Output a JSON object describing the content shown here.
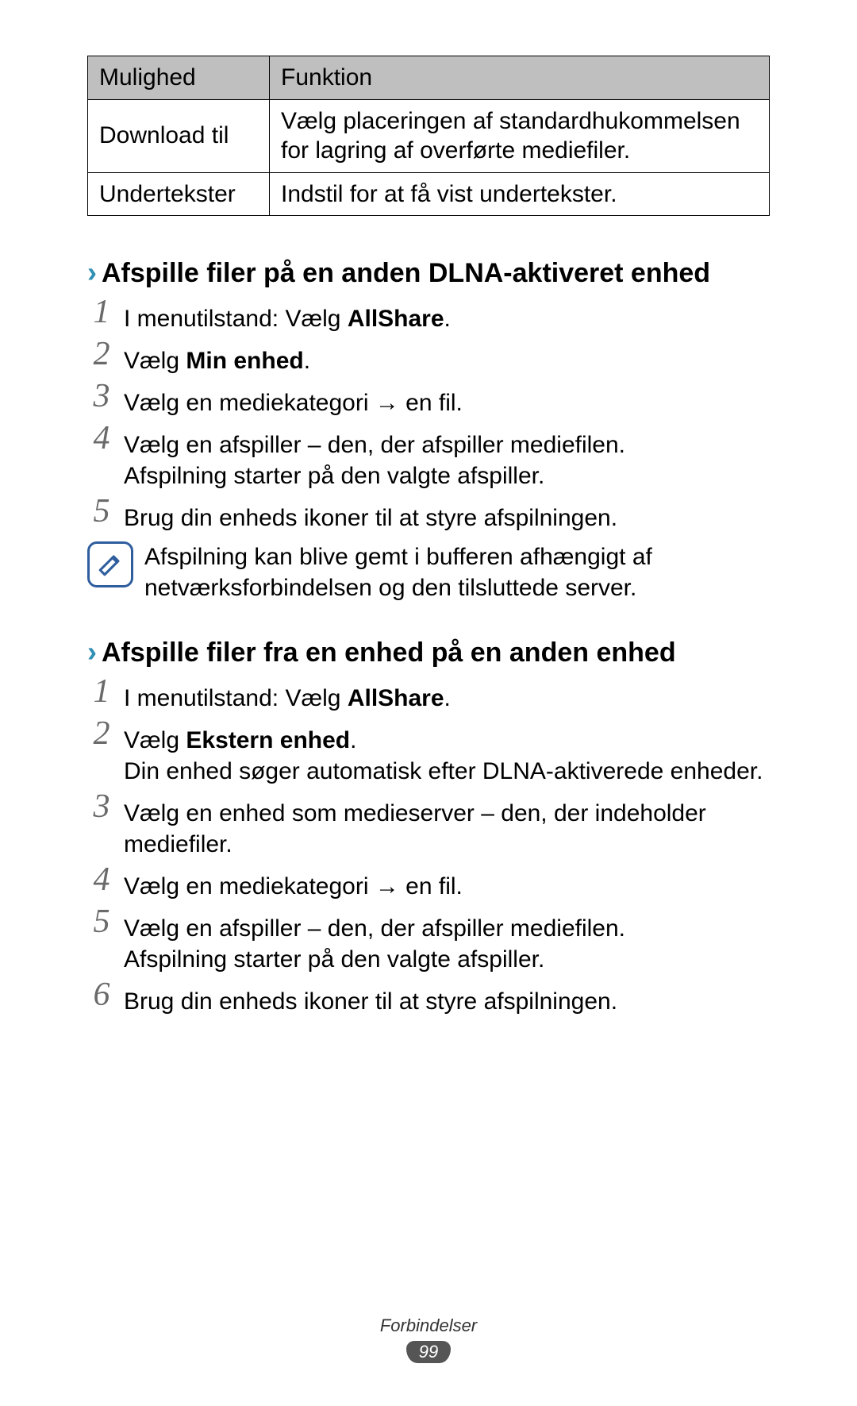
{
  "table": {
    "headers": [
      "Mulighed",
      "Funktion"
    ],
    "rows": [
      {
        "option": "Download til",
        "func": "Vælg placeringen af standardhukommelsen for lagring af overførte mediefiler."
      },
      {
        "option": "Undertekster",
        "func": "Indstil for at få vist undertekster."
      }
    ]
  },
  "section1": {
    "title": "Afspille filer på en anden DLNA-aktiveret enhed",
    "steps": {
      "s1_pre": "I menutilstand: Vælg ",
      "s1_bold": "AllShare",
      "s1_post": ".",
      "s2_pre": "Vælg ",
      "s2_bold": "Min enhed",
      "s2_post": ".",
      "s3": "Vælg en mediekategori → en fil.",
      "s4a": "Vælg en afspiller – den, der afspiller mediefilen.",
      "s4b": "Afspilning starter på den valgte afspiller.",
      "s5": "Brug din enheds ikoner til at styre afspilningen."
    },
    "note": "Afspilning kan blive gemt i bufferen afhængigt af netværksforbindelsen og den tilsluttede server."
  },
  "section2": {
    "title": "Afspille filer fra en enhed på en anden enhed",
    "steps": {
      "s1_pre": "I menutilstand: Vælg ",
      "s1_bold": "AllShare",
      "s1_post": ".",
      "s2_pre": "Vælg ",
      "s2_bold": "Ekstern enhed",
      "s2_post": ".",
      "s2b": "Din enhed søger automatisk efter DLNA-aktiverede enheder.",
      "s3": "Vælg en enhed som medieserver – den, der indeholder mediefiler.",
      "s4": "Vælg en mediekategori → en fil.",
      "s5a": "Vælg en afspiller – den, der afspiller mediefilen.",
      "s5b": "Afspilning starter på den valgte afspiller.",
      "s6": "Brug din enheds ikoner til at styre afspilningen."
    }
  },
  "footer": {
    "section": "Forbindelser",
    "page": "99"
  },
  "icons": {
    "chevron": "›",
    "note": "pencil-square-icon"
  }
}
